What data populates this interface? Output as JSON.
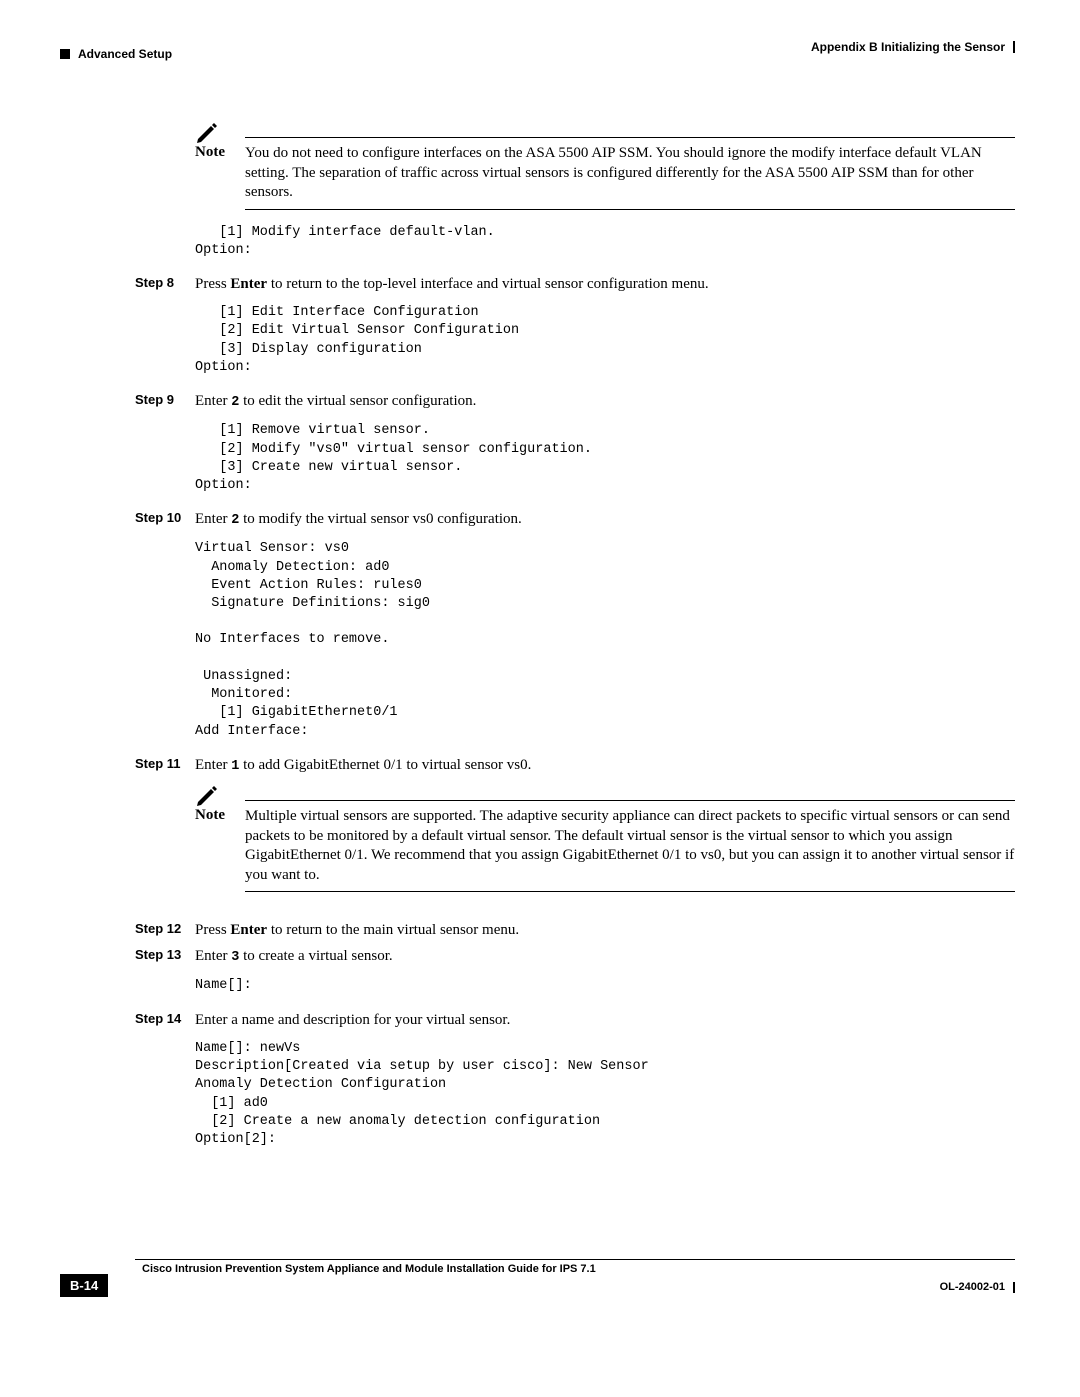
{
  "header": {
    "left": "Advanced Setup",
    "right": "Appendix B      Initializing the Sensor"
  },
  "note1": {
    "label": "Note",
    "text": "You do not need to configure interfaces on the ASA 5500 AIP SSM. You should ignore the modify interface default VLAN setting. The separation of traffic across virtual sensors is configured differently for the ASA 5500 AIP SSM than for other sensors."
  },
  "code1": "   [1] Modify interface default-vlan.\nOption:",
  "step8": {
    "label": "Step 8",
    "pre": "Press ",
    "bold": "Enter",
    "post": " to return to the top-level interface and virtual sensor configuration menu."
  },
  "code8": "   [1] Edit Interface Configuration\n   [2] Edit Virtual Sensor Configuration\n   [3] Display configuration\nOption:",
  "step9": {
    "label": "Step 9",
    "pre": "Enter ",
    "mono": "2",
    "post": " to edit the virtual sensor configuration."
  },
  "code9": "   [1] Remove virtual sensor.\n   [2] Modify \"vs0\" virtual sensor configuration.\n   [3] Create new virtual sensor.\nOption:",
  "step10": {
    "label": "Step 10",
    "pre": "Enter ",
    "mono": "2",
    "post": " to modify the virtual sensor vs0 configuration."
  },
  "code10": "Virtual Sensor: vs0\n  Anomaly Detection: ad0\n  Event Action Rules: rules0\n  Signature Definitions: sig0\n\nNo Interfaces to remove.\n\n Unassigned:\n  Monitored:\n   [1] GigabitEthernet0/1\nAdd Interface:",
  "step11": {
    "label": "Step 11",
    "pre": "Enter ",
    "mono": "1",
    "post": " to add GigabitEthernet 0/1 to virtual sensor vs0."
  },
  "note2": {
    "label": "Note",
    "text": "Multiple virtual sensors are supported. The adaptive security appliance can direct packets to specific virtual sensors or can send packets to be monitored by a default virtual sensor. The default virtual sensor is the virtual sensor to which you assign GigabitEthernet 0/1. We recommend that you assign GigabitEthernet 0/1 to vs0, but you can assign it to another virtual sensor if you want to."
  },
  "step12": {
    "label": "Step 12",
    "pre": "Press ",
    "bold": "Enter",
    "post": " to return to the main virtual sensor menu."
  },
  "step13": {
    "label": "Step 13",
    "pre": "Enter ",
    "mono": "3",
    "post": " to create a virtual sensor."
  },
  "code13": "Name[]:",
  "step14": {
    "label": "Step 14",
    "text": "Enter a name and description for your virtual sensor."
  },
  "code14": "Name[]: newVs\nDescription[Created via setup by user cisco]: New Sensor\nAnomaly Detection Configuration\n  [1] ad0\n  [2] Create a new anomaly detection configuration\nOption[2]:",
  "footer": {
    "title": "Cisco Intrusion Prevention System Appliance and Module Installation Guide for IPS 7.1",
    "pagenum": "B-14",
    "docnum": "OL-24002-01"
  }
}
